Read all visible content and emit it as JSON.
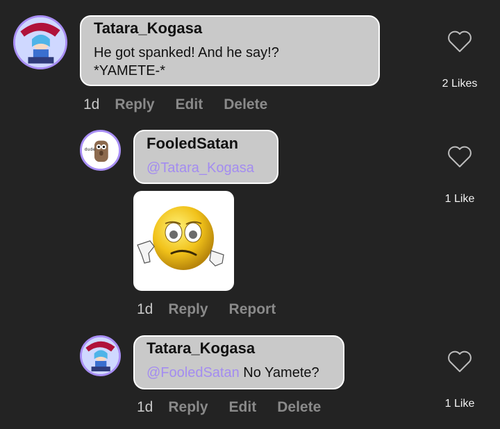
{
  "comments": [
    {
      "author": "Tatara_Kogasa",
      "text_lines": [
        "He got spanked! And he say!?",
        "*YAMETE-*"
      ],
      "time": "1d",
      "actions": [
        "Reply",
        "Edit",
        "Delete"
      ],
      "likes": "2 Likes"
    },
    {
      "author": "FooledSatan",
      "mention": "@Tatara_Kogasa",
      "time": "1d",
      "actions": [
        "Reply",
        "Report"
      ],
      "likes": "1 Like",
      "avatar_badge": "dude"
    },
    {
      "author": "Tatara_Kogasa",
      "mention": "@FooledSatan",
      "text": " No Yamete?",
      "time": "1d",
      "actions": [
        "Reply",
        "Edit",
        "Delete"
      ],
      "likes": "1 Like"
    }
  ],
  "colors": {
    "background": "#232323",
    "bubble": "#c9c9c9",
    "mention": "#a38cf0",
    "avatar_ring": "#a88ef5",
    "action_text": "#8a8a8a"
  },
  "icons": [
    "heart-outline-icon"
  ]
}
